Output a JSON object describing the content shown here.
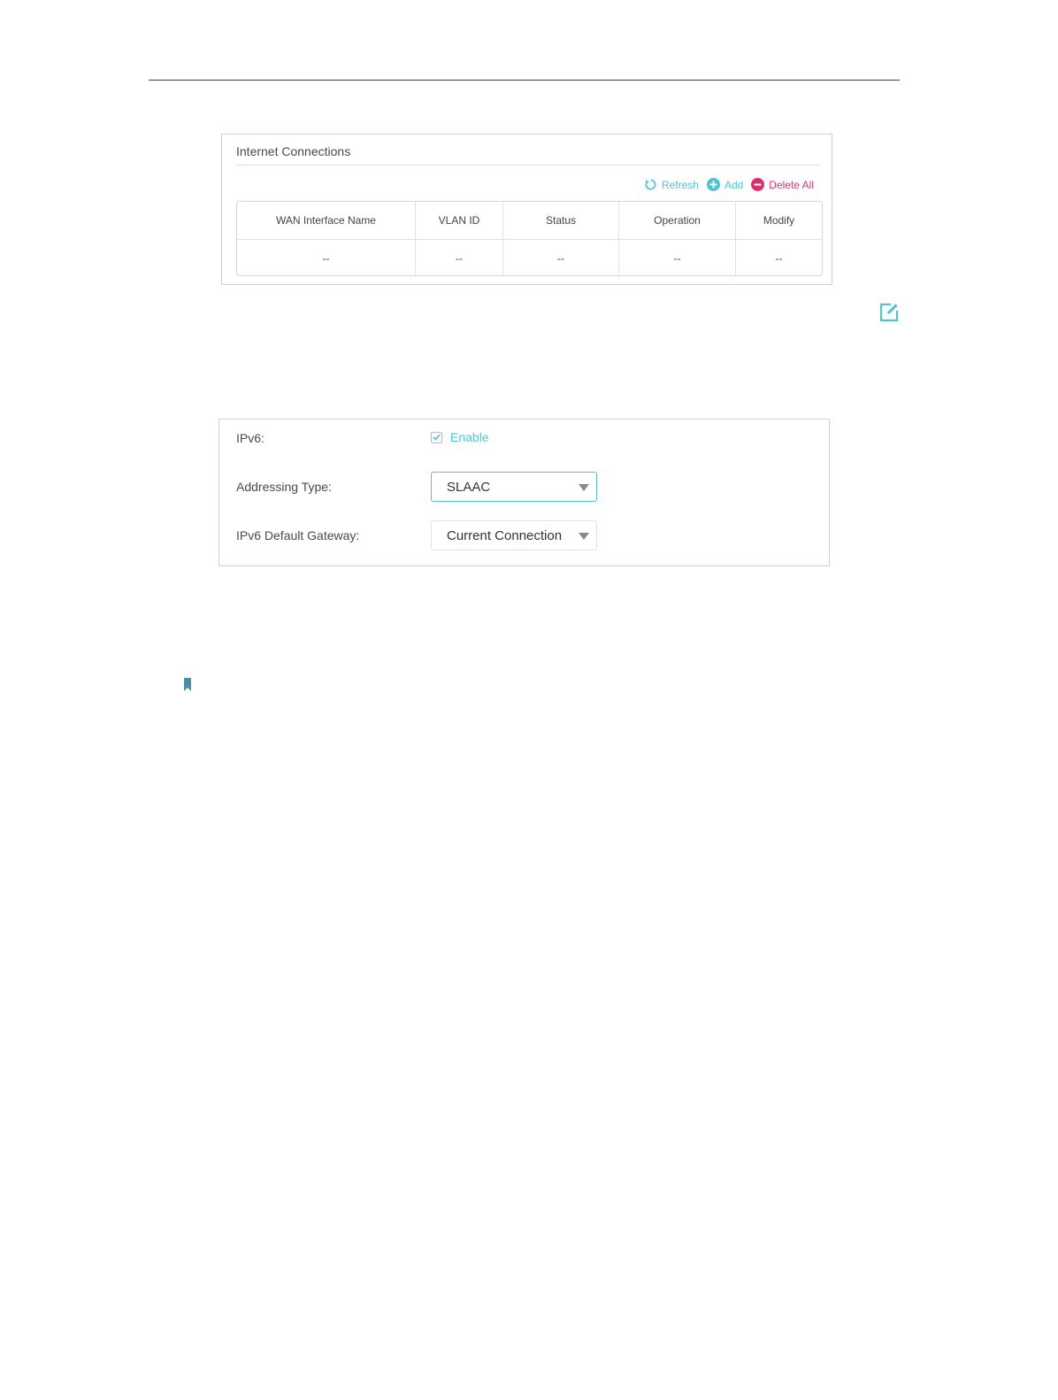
{
  "internet_connections": {
    "title": "Internet Connections",
    "toolbar": {
      "refresh_label": "Refresh",
      "add_label": "Add",
      "delete_all_label": "Delete All"
    },
    "columns": [
      "WAN Interface Name",
      "VLAN ID",
      "Status",
      "Operation",
      "Modify"
    ],
    "rows": [
      [
        "--",
        "--",
        "--",
        "--",
        "--"
      ]
    ]
  },
  "ipv6_settings": {
    "ipv6_label": "IPv6:",
    "enable_label": "Enable",
    "enable_checked": true,
    "addressing_type_label": "Addressing Type:",
    "addressing_type_value": "SLAAC",
    "default_gateway_label": "IPv6 Default Gateway:",
    "default_gateway_value": "Current Connection"
  },
  "icons": {
    "refresh": "refresh-icon",
    "add": "plus-circle-icon",
    "delete_all": "minus-circle-icon",
    "note": "edit-note-icon",
    "tip": "bookmark-icon"
  },
  "colors": {
    "accent": "#4fc3d4",
    "danger": "#d6336c",
    "border": "#cfcfcf"
  }
}
